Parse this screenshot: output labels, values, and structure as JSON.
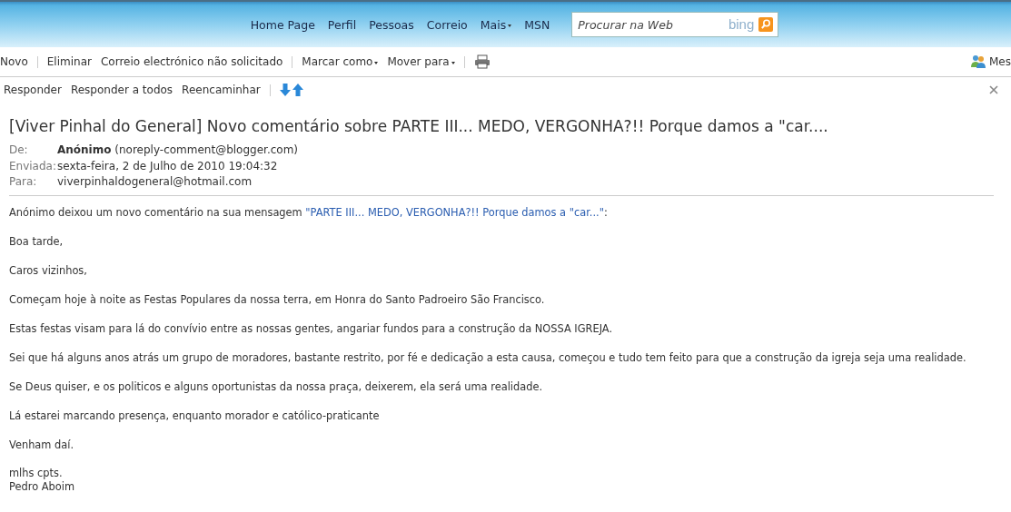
{
  "header": {
    "nav": [
      {
        "label": "Home Page",
        "dropdown": false
      },
      {
        "label": "Perfil",
        "dropdown": false
      },
      {
        "label": "Pessoas",
        "dropdown": false
      },
      {
        "label": "Correio",
        "dropdown": false
      },
      {
        "label": "Mais",
        "dropdown": true
      },
      {
        "label": "MSN",
        "dropdown": false
      }
    ],
    "search": {
      "placeholder": "Procurar na Web",
      "brand": "bing"
    }
  },
  "toolbar": {
    "items": [
      {
        "kind": "text",
        "label": "Novo",
        "dropdown": false
      },
      {
        "kind": "divider"
      },
      {
        "kind": "text",
        "label": "Eliminar",
        "dropdown": false
      },
      {
        "kind": "text",
        "label": "Correio electrónico não solicitado",
        "dropdown": false
      },
      {
        "kind": "divider"
      },
      {
        "kind": "text",
        "label": "Marcar como",
        "dropdown": true
      },
      {
        "kind": "text",
        "label": "Mover para",
        "dropdown": true
      },
      {
        "kind": "divider"
      },
      {
        "kind": "print"
      }
    ],
    "right": "Mes"
  },
  "actions": {
    "items": [
      "Responder",
      "Responder a todos",
      "Reencaminhar"
    ]
  },
  "message": {
    "subject": "[Viver Pinhal do General] Novo comentário sobre PARTE III... MEDO, VERGONHA?!! Porque damos a \"car....",
    "fields": [
      {
        "label": "De:",
        "name": "Anónimo",
        "value": "(noreply-comment@blogger.com)"
      },
      {
        "label": "Enviada:",
        "value": "sexta-feira, 2 de Julho de 2010 19:04:32"
      },
      {
        "label": "Para:",
        "value": "viverpinhaldogeneral@hotmail.com"
      }
    ],
    "intro": {
      "before": "Anónimo deixou um novo comentário na sua mensagem ",
      "link": "\"PARTE III... MEDO, VERGONHA?!! Porque damos a \"car...\"",
      "after": ":"
    },
    "paragraphs": [
      "Boa tarde,",
      "Caros vizinhos,",
      "Começam hoje à noite as Festas Populares da nossa terra, em Honra do Santo Padroeiro São Francisco.",
      "Estas festas visam para lá do convívio entre as nossas gentes, angariar fundos para a construção da NOSSA IGREJA.",
      "Sei que há alguns anos atrás um grupo de moradores, bastante restrito, por fé e dedicação a esta causa, começou e tudo tem feito para que a construção da igreja seja uma realidade.",
      "Se Deus quiser, e os politicos e alguns oportunistas da nossa praça, deixerem, ela será uma realidade.",
      "Lá estarei marcando presença, enquanto morador e católico-praticante",
      "Venham daí."
    ],
    "signature": [
      "mlhs cpts.",
      "Pedro Aboim"
    ]
  }
}
